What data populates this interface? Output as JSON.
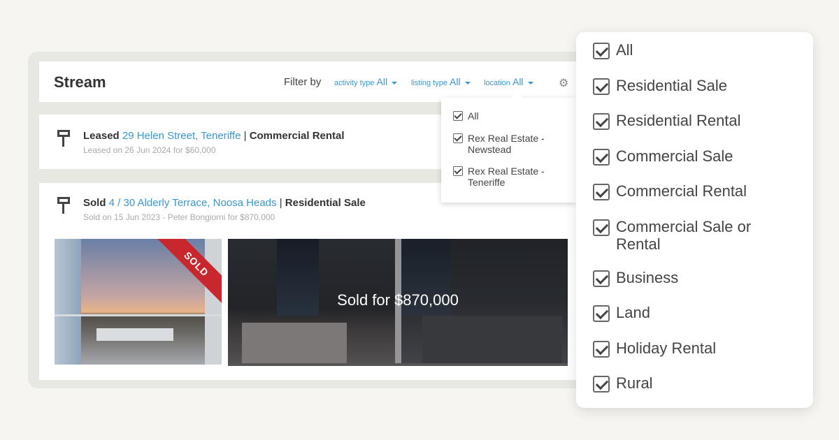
{
  "header": {
    "title": "Stream",
    "filter_by_label": "Filter by",
    "filters": [
      {
        "label": "activity type",
        "value": "All"
      },
      {
        "label": "listing type",
        "value": "All"
      },
      {
        "label": "location",
        "value": "All"
      }
    ],
    "settings_icon": "gear-icon"
  },
  "activities": [
    {
      "icon": "flag-icon",
      "action": "Leased",
      "address": "29 Helen Street, Teneriffe",
      "separator": "|",
      "listing_type": "Commercial Rental",
      "detail": "Leased on 26 Jun 2024 for $60,000"
    },
    {
      "icon": "flag-icon",
      "action": "Sold",
      "address": "4 / 30 Alderly Terrace, Noosa Heads",
      "separator": "|",
      "listing_type": "Residential Sale",
      "detail": "Sold on 15 Jun 2023 - Peter Bongiorni for $870,000",
      "ribbon": "SOLD",
      "overlay_text": "Sold for $870,000"
    }
  ],
  "location_dropdown": {
    "options": [
      {
        "label": "All",
        "checked": true
      },
      {
        "label": "Rex Real Estate - Newstead",
        "checked": true
      },
      {
        "label": "Rex Real Estate - Teneriffe",
        "checked": true
      }
    ]
  },
  "listing_type_dropdown": {
    "options": [
      {
        "label": "All",
        "checked": true
      },
      {
        "label": "Residential Sale",
        "checked": true
      },
      {
        "label": "Residential Rental",
        "checked": true
      },
      {
        "label": "Commercial Sale",
        "checked": true
      },
      {
        "label": "Commercial Rental",
        "checked": true
      },
      {
        "label": "Commercial Sale or Rental",
        "checked": true
      },
      {
        "label": "Business",
        "checked": true
      },
      {
        "label": "Land",
        "checked": true
      },
      {
        "label": "Holiday Rental",
        "checked": true
      },
      {
        "label": "Rural",
        "checked": true
      }
    ]
  },
  "colors": {
    "link": "#3a97cf",
    "ribbon": "#c8282d",
    "background": "#f6f5f1"
  }
}
